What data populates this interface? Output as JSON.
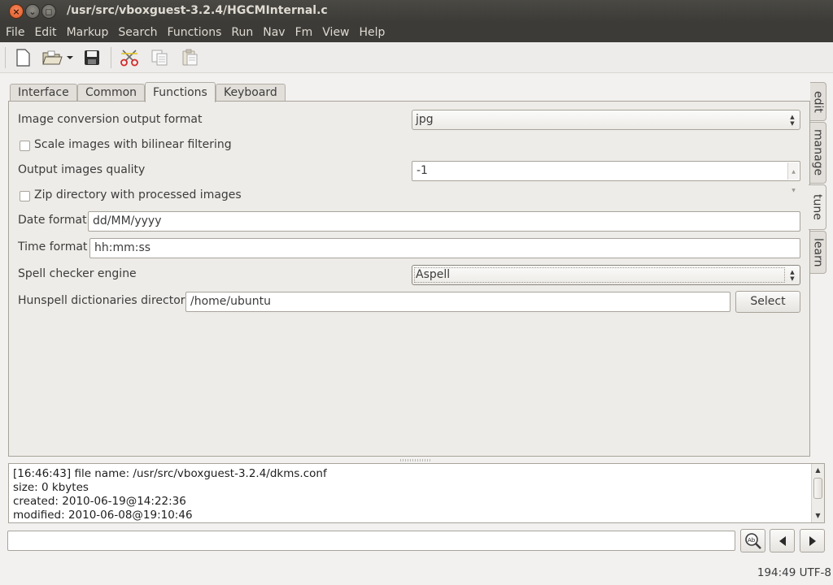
{
  "window": {
    "title": "/usr/src/vboxguest-3.2.4/HGCMInternal.c",
    "controls": {
      "close": "×",
      "minimize": "⌄",
      "maximize": "◻"
    }
  },
  "menubar": {
    "items": [
      "File",
      "Edit",
      "Markup",
      "Search",
      "Functions",
      "Run",
      "Nav",
      "Fm",
      "View",
      "Help"
    ]
  },
  "toolbar": {
    "icons": [
      "new-file-icon",
      "open-folder-icon",
      "dropdown-arrow-icon",
      "save-icon",
      "cut-icon",
      "copy-icon",
      "paste-icon"
    ]
  },
  "tabs": {
    "items": [
      "Interface",
      "Common",
      "Functions",
      "Keyboard"
    ],
    "active": "Functions"
  },
  "functions": {
    "image_format_label": "Image conversion output format",
    "image_format_value": "jpg",
    "bilinear_label": "Scale images with bilinear filtering",
    "bilinear_checked": false,
    "quality_label": "Output images quality",
    "quality_value": "-1",
    "zip_label": "Zip directory with processed images",
    "zip_checked": false,
    "date_label": "Date format",
    "date_value": "dd/MM/yyyy",
    "time_label": "Time format",
    "time_value": "hh:mm:ss",
    "spell_label": "Spell checker engine",
    "spell_value": "Aspell",
    "hunspell_label": "Hunspell dictionaries directory",
    "hunspell_value": "/home/ubuntu",
    "select_button": "Select"
  },
  "side_tabs": {
    "items": [
      "edit",
      "manage",
      "tune",
      "learn"
    ],
    "active": "tune"
  },
  "output": {
    "lines": [
      "[16:46:43] file name: /usr/src/vboxguest-3.2.4/dkms.conf",
      "size: 0 kbytes",
      "created: 2010-06-19@14:22:36",
      "modified: 2010-06-08@19:10:46"
    ]
  },
  "commandbar": {
    "value": "",
    "icons": [
      "spellcheck-icon",
      "back-arrow-icon",
      "forward-arrow-icon"
    ]
  },
  "statusbar": {
    "text": "194:49 UTF-8"
  },
  "colors": {
    "titlebar": "#3c3b37",
    "close_button": "#e05a2a",
    "window_bg": "#f2f1f0"
  }
}
